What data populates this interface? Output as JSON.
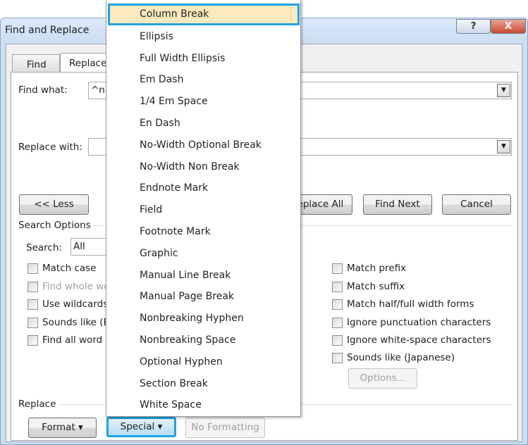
{
  "window": {
    "title": "Find and Replace",
    "help_icon": "?",
    "close_icon": "X"
  },
  "tabs": [
    {
      "label": "Find"
    },
    {
      "label": "Replace"
    }
  ],
  "find_what": {
    "label": "Find what:",
    "value": "^n"
  },
  "replace_with": {
    "label": "Replace with:",
    "value": ""
  },
  "buttons": {
    "less": "<< Less",
    "replace_all": "Replace All",
    "find_next": "Find Next",
    "cancel": "Cancel",
    "options": "Options...",
    "format": "Format ▾",
    "special": "Special ▾",
    "no_formatting": "No Formatting"
  },
  "search_options": {
    "heading": "Search Options",
    "search_label": "Search:",
    "search_value": "All"
  },
  "left_checks": [
    {
      "label": "Match case",
      "disabled": false
    },
    {
      "label": "Find whole wo",
      "disabled": true
    },
    {
      "label": "Use wildcards",
      "disabled": false
    },
    {
      "label": "Sounds like (E",
      "disabled": false
    },
    {
      "label": "Find all word f",
      "disabled": false
    }
  ],
  "right_checks": [
    {
      "label": "Match prefix"
    },
    {
      "label": "Match suffix"
    },
    {
      "label": "Match half/full width forms"
    },
    {
      "label": "Ignore punctuation characters"
    },
    {
      "label": "Ignore white-space characters"
    },
    {
      "label": "Sounds like (Japanese)"
    }
  ],
  "replace_section": {
    "heading": "Replace"
  },
  "special_menu": {
    "items": [
      "Column Break",
      "Ellipsis",
      "Full Width Ellipsis",
      "Em Dash",
      "1/4 Em Space",
      "En Dash",
      "No-Width Optional Break",
      "No-Width Non Break",
      "Endnote Mark",
      "Field",
      "Footnote Mark",
      "Graphic",
      "Manual Line Break",
      "Manual Page Break",
      "Nonbreaking Hyphen",
      "Nonbreaking Space",
      "Optional Hyphen",
      "Section Break",
      "White Space"
    ],
    "highlighted": 0,
    "highlight_color": "#fce9bd",
    "focus_color": "#1ea2e5"
  }
}
